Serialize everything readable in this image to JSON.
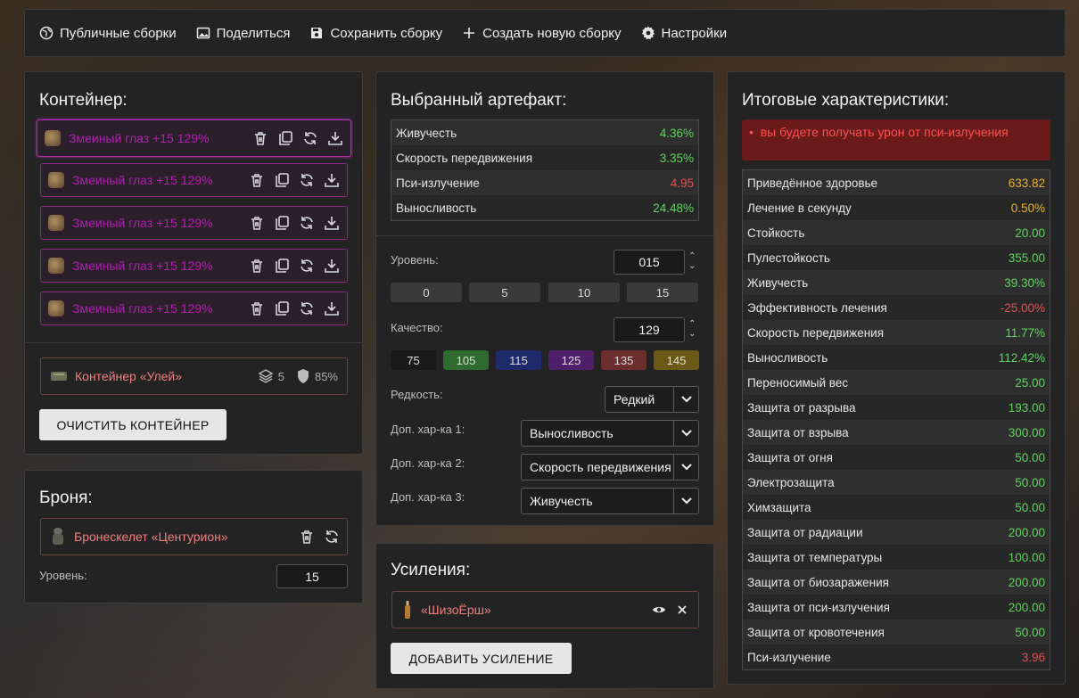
{
  "nav": [
    {
      "label": "Публичные сборки",
      "icon": "globe-icon"
    },
    {
      "label": "Поделиться",
      "icon": "image-icon"
    },
    {
      "label": "Сохранить сборку",
      "icon": "save-icon"
    },
    {
      "label": "Создать новую сборку",
      "icon": "plus-icon"
    },
    {
      "label": "Настройки",
      "icon": "gear-icon"
    }
  ],
  "container": {
    "title": "Контейнер:",
    "artifacts": [
      {
        "name": "Змеиный глаз +15 129%"
      },
      {
        "name": "Змеиный глаз +15 129%"
      },
      {
        "name": "Змеиный глаз +15 129%"
      },
      {
        "name": "Змеиный глаз +15 129%"
      },
      {
        "name": "Змеиный глаз +15 129%"
      }
    ],
    "box_name": "Контейнер «Улей»",
    "slots": "5",
    "protection": "85%",
    "clear_label": "ОЧИСТИТЬ КОНТЕЙНЕР"
  },
  "armor": {
    "title": "Броня:",
    "name": "Бронескелет «Центурион»",
    "level_label": "Уровень:",
    "level_value": "15"
  },
  "artifact": {
    "title": "Выбранный артефакт:",
    "stats": [
      {
        "name": "Живучесть",
        "value": "4.36%",
        "color": "green"
      },
      {
        "name": "Скорость передвижения",
        "value": "3.35%",
        "color": "green"
      },
      {
        "name": "Пси-излучение",
        "value": "4.95",
        "color": "red"
      },
      {
        "name": "Выносливость",
        "value": "24.48%",
        "color": "green"
      }
    ],
    "level_label": "Уровень:",
    "level_value": "015",
    "level_presets": [
      "0",
      "5",
      "10",
      "15"
    ],
    "quality_label": "Качество:",
    "quality_value": "129",
    "quality_presets": [
      {
        "label": "75",
        "color": "#1a1a1a"
      },
      {
        "label": "105",
        "color": "#2e6b2e"
      },
      {
        "label": "115",
        "color": "#1f2a6b"
      },
      {
        "label": "125",
        "color": "#4f1f6b"
      },
      {
        "label": "135",
        "color": "#6b2f2f"
      },
      {
        "label": "145",
        "color": "#6b5a16"
      }
    ],
    "rarity_label": "Редкость:",
    "rarity_value": "Редкий",
    "extra1_label": "Доп. хар-ка 1:",
    "extra1_value": "Выносливость",
    "extra2_label": "Доп. хар-ка 2:",
    "extra2_value": "Скорость передвижения",
    "extra3_label": "Доп. хар-ка 3:",
    "extra3_value": "Живучесть"
  },
  "boosts": {
    "title": "Усиления:",
    "item": "«ШизоЁрш»",
    "add_label": "ДОБАВИТЬ УСИЛЕНИЕ"
  },
  "totals": {
    "title": "Итоговые характеристики:",
    "alert": "вы будете получать урон от пси-излучения",
    "stats": [
      {
        "name": "Приведённое здоровье",
        "value": "633.82",
        "color": "yellow"
      },
      {
        "name": "Лечение в секунду",
        "value": "0.50%",
        "color": "yellow"
      },
      {
        "name": "Стойкость",
        "value": "20.00",
        "color": "green"
      },
      {
        "name": "Пулестойкость",
        "value": "355.00",
        "color": "green"
      },
      {
        "name": "Живучесть",
        "value": "39.30%",
        "color": "green"
      },
      {
        "name": "Эффективность лечения",
        "value": "-25.00%",
        "color": "red"
      },
      {
        "name": "Скорость передвижения",
        "value": "11.77%",
        "color": "green"
      },
      {
        "name": "Выносливость",
        "value": "112.42%",
        "color": "green"
      },
      {
        "name": "Переносимый вес",
        "value": "25.00",
        "color": "green"
      },
      {
        "name": "Защита от разрыва",
        "value": "193.00",
        "color": "green"
      },
      {
        "name": "Защита от взрыва",
        "value": "300.00",
        "color": "green"
      },
      {
        "name": "Защита от огня",
        "value": "50.00",
        "color": "green"
      },
      {
        "name": "Электрозащита",
        "value": "50.00",
        "color": "green"
      },
      {
        "name": "Химзащита",
        "value": "50.00",
        "color": "green"
      },
      {
        "name": "Защита от радиации",
        "value": "200.00",
        "color": "green"
      },
      {
        "name": "Защита от температуры",
        "value": "100.00",
        "color": "green"
      },
      {
        "name": "Защита от биозаражения",
        "value": "200.00",
        "color": "green"
      },
      {
        "name": "Защита от пси-излучения",
        "value": "200.00",
        "color": "green"
      },
      {
        "name": "Защита от кровотечения",
        "value": "50.00",
        "color": "green"
      },
      {
        "name": "Пси-излучение",
        "value": "3.96",
        "color": "red"
      }
    ]
  }
}
